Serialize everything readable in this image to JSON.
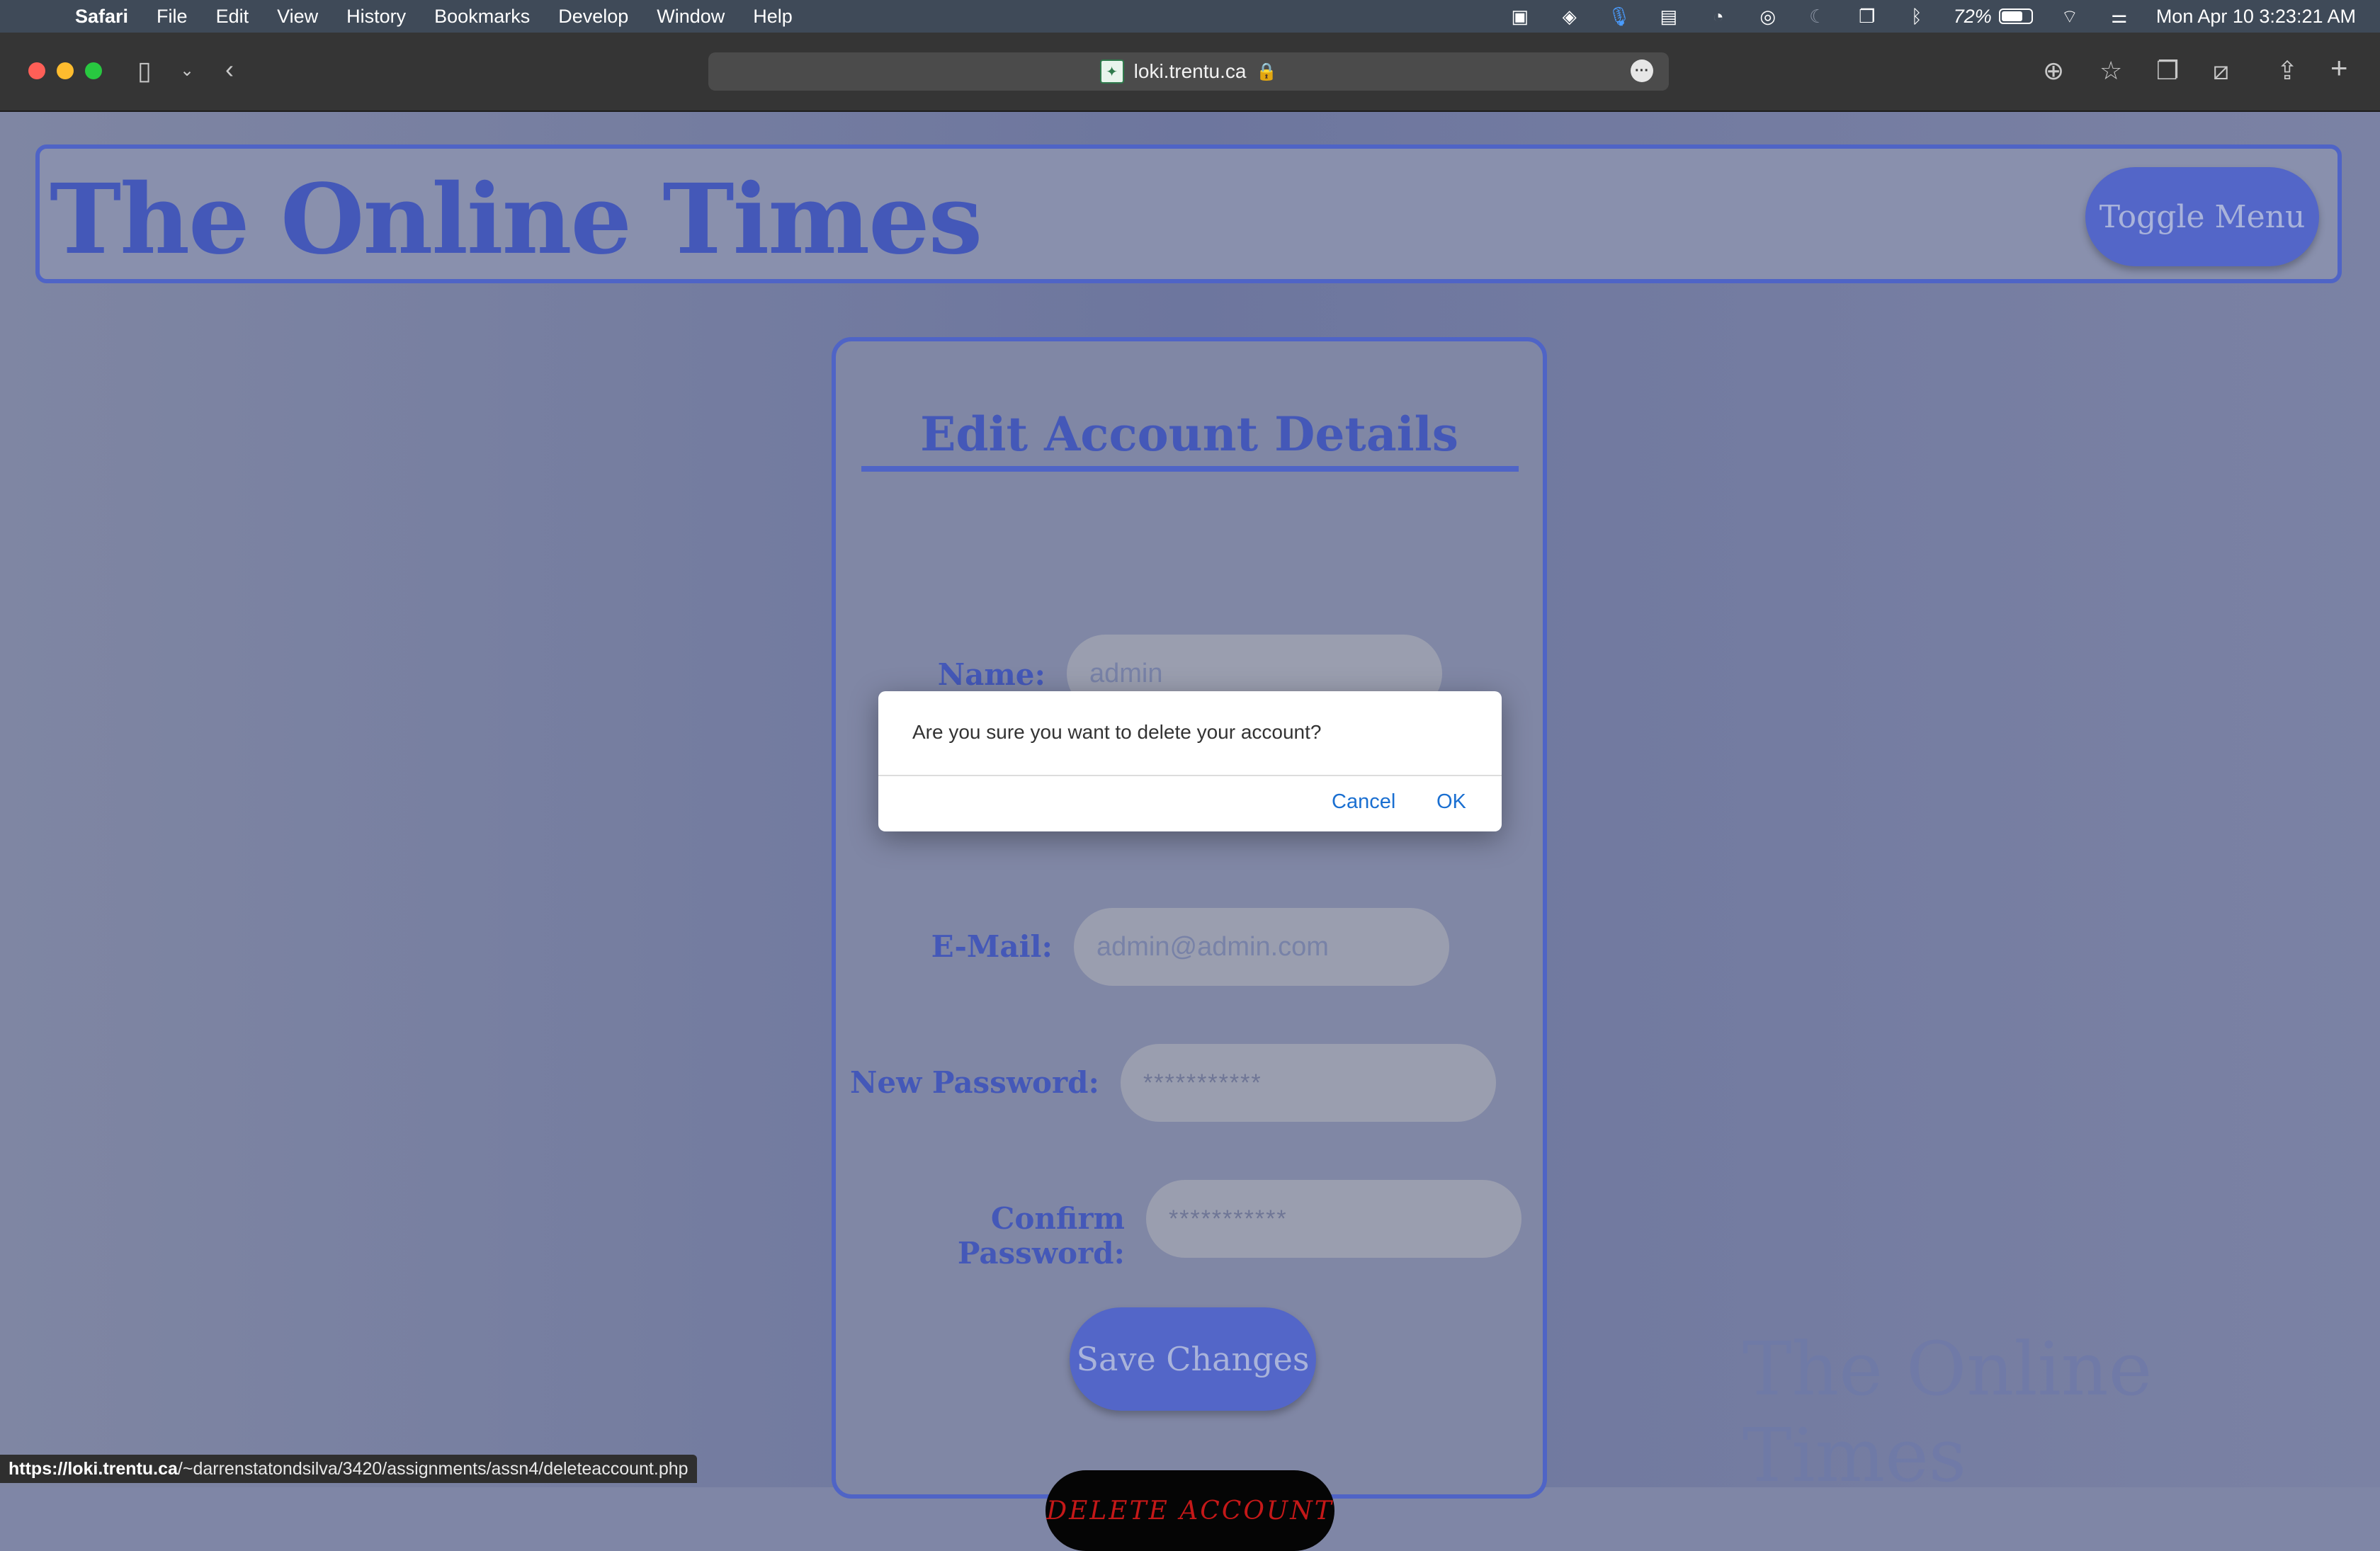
{
  "menubar": {
    "app": "Safari",
    "items": [
      "File",
      "Edit",
      "View",
      "History",
      "Bookmarks",
      "Develop",
      "Window",
      "Help"
    ],
    "battery_percent": "72%",
    "battery_level": 0.72,
    "datetime": "Mon Apr 10  3:23:21 AM"
  },
  "browser": {
    "url_host": "loki.trentu.ca",
    "status_url_host": "https://loki.trentu.ca",
    "status_url_path": "/~darrenstatondsilva/3420/assignments/assn4/deleteaccount.php"
  },
  "site": {
    "title": "The Online Times",
    "toggle_menu": "Toggle Menu",
    "watermark": "The Online Times"
  },
  "form": {
    "title": "Edit Account Details",
    "name_label": "Name:",
    "name_value": "admin",
    "email_label": "E-Mail:",
    "email_value": "admin@admin.com",
    "new_password_label": "New Password:",
    "new_password_value": "***********",
    "confirm_password_label": "Confirm Password:",
    "confirm_password_value": "***********",
    "save_button": "Save Changes",
    "delete_button": "DELETE ACCOUNT"
  },
  "dialog": {
    "message": "Are you sure you want to delete your account?",
    "cancel": "Cancel",
    "ok": "OK"
  },
  "colors": {
    "accent": "#4f64c6",
    "dialog_link": "#1a6fd1",
    "delete_text": "#c41818"
  }
}
